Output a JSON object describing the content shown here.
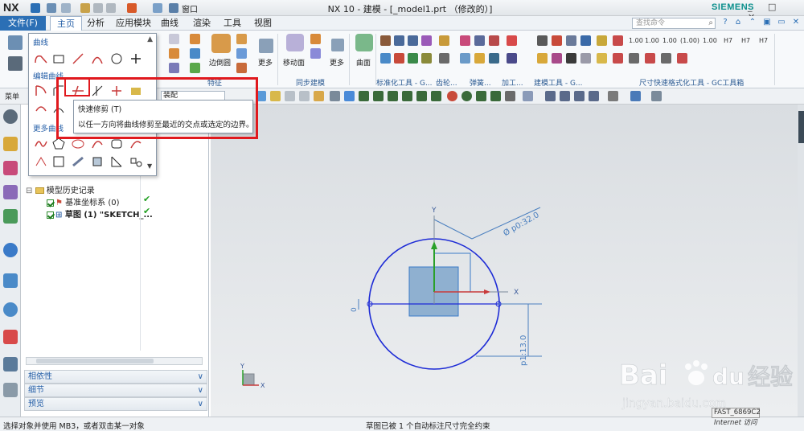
{
  "titlebar": {
    "logo": "NX",
    "window_menu": "窗口",
    "title": "NX 10 - 建模 - [_model1.prt （修改的）]",
    "brand": "SIEMENS",
    "controls": "_ □ ✕"
  },
  "menubar": {
    "file": "文件(F)",
    "tabs": [
      "主页",
      "分析",
      "应用模块",
      "曲线",
      "渲染",
      "工具",
      "视图"
    ],
    "active_tab": "主页",
    "search_placeholder": "查找命令"
  },
  "ribbon": {
    "groups": [
      "特征",
      "同步建模",
      "标准化工具 - G...",
      "齿轮...",
      "弹簧...",
      "加工...",
      "建模工具 - G...",
      "尺寸快速格式化工具 - GC工具箱"
    ],
    "big_buttons": [
      "边倒圆",
      "更多",
      "移动面",
      "更多",
      "曲面",
      "更多"
    ],
    "dim_labels": [
      "1.00",
      "1.00",
      "1.00",
      "(1.00)",
      "1.00",
      "H7",
      "H7",
      "H7"
    ]
  },
  "curve_menu": {
    "sections": [
      "曲线",
      "编辑曲线",
      "更多曲线"
    ]
  },
  "tooltip": {
    "title": "快速修剪 (T)",
    "description": "以任一方向将曲线修剪至最近的交点或选定的边界。"
  },
  "toolbar2": {
    "left_label": "菜单",
    "dropdown_label": "装配"
  },
  "navigator": {
    "history_label": "模型历史记录",
    "items": [
      {
        "name": "基准坐标系 (0)",
        "status": "✔"
      },
      {
        "name": "草图 (1) \"SKETCH_...",
        "status": "✔"
      }
    ],
    "panels": [
      "相依性",
      "细节",
      "预览"
    ]
  },
  "sketch": {
    "dim_diameter": "Ø p0:32.0",
    "dim_height": "p1:13.0",
    "dim_zero": "0",
    "axis_x": "X",
    "axis_y": "Y",
    "triad_x": "X",
    "triad_y": "Y"
  },
  "status": {
    "left": "选择对象并使用 MB3，或者双击某一对象",
    "center": "草图已被 1 个自动标注尺寸完全约束",
    "fast": "FAST_6869C2",
    "internet": "Internet 访问"
  },
  "watermark": {
    "brand": "Bai",
    "brand2": "du",
    "cn": "经验",
    "url": "jingyan.baidu.com"
  },
  "colors": {
    "accent": "#2b6fb5",
    "highlight": "#e0191e",
    "sketch": "#1d2bd6",
    "dimension": "#4a7fbf"
  }
}
